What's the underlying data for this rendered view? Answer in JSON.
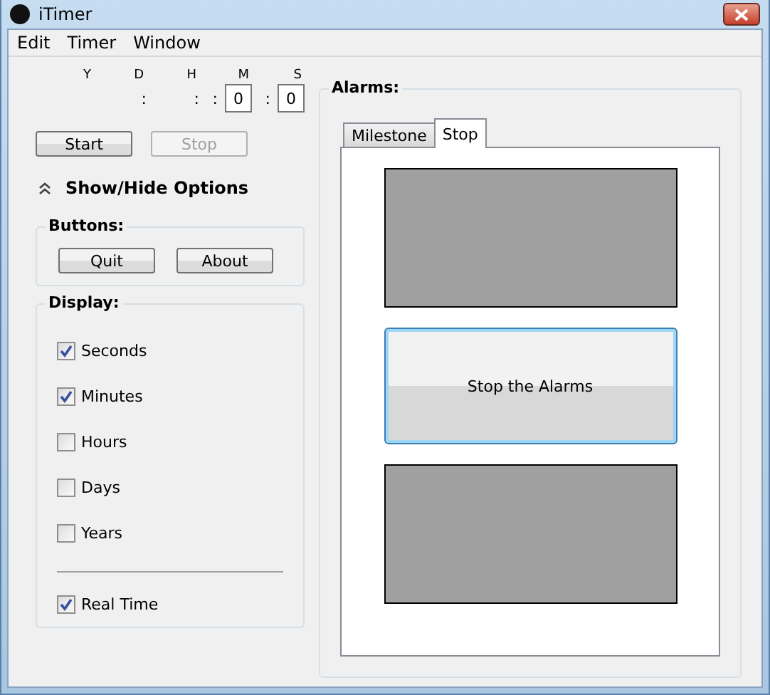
{
  "window": {
    "title": "iTimer"
  },
  "menu": [
    "Edit",
    "Timer",
    "Window"
  ],
  "time_units": [
    {
      "label": "Y"
    },
    {
      "label": "D",
      "separator": ":"
    },
    {
      "label": "H",
      "separator": ":"
    },
    {
      "label": "M",
      "separator": ":",
      "value": "0"
    },
    {
      "label": "S",
      "separator": ":",
      "value": "0"
    }
  ],
  "timer_buttons": [
    {
      "label": "Start",
      "disabled": false
    },
    {
      "label": "Stop",
      "disabled": true
    }
  ],
  "options_toggle": {
    "label": "Show/Hide Options",
    "expanded": true
  },
  "buttons_group": {
    "title": "Buttons:",
    "buttons": [
      "Quit",
      "About"
    ]
  },
  "display_group": {
    "title": "Display:",
    "options": [
      {
        "label": "Seconds",
        "checked": true
      },
      {
        "label": "Minutes",
        "checked": true
      },
      {
        "label": "Hours",
        "checked": false
      },
      {
        "label": "Days",
        "checked": false
      },
      {
        "label": "Years",
        "checked": false
      }
    ],
    "extra_options": [
      {
        "label": "Real Time",
        "checked": true
      }
    ]
  },
  "alarms_group": {
    "title": "Alarms:",
    "tabs": [
      {
        "label": "Milestone",
        "selected": false
      },
      {
        "label": "Stop",
        "selected": true
      }
    ],
    "panels": [
      {
        "kind": "blank"
      },
      {
        "kind": "button",
        "label": "Stop the Alarms"
      },
      {
        "kind": "blank"
      }
    ]
  }
}
